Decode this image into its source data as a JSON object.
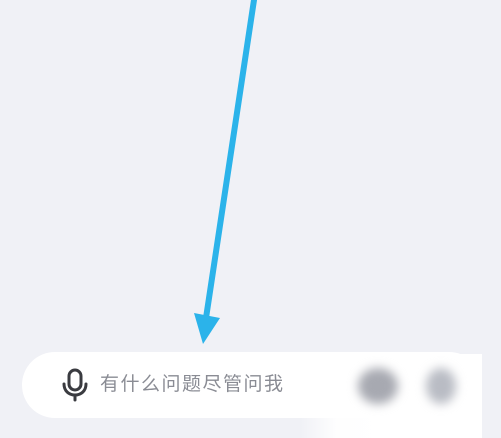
{
  "input": {
    "placeholder": "有什么问题尽管问我"
  },
  "icons": {
    "mic": "microphone-icon",
    "arrow": "annotation-arrow-icon"
  },
  "colors": {
    "background": "#f0f1f6",
    "input_bar": "#ffffff",
    "placeholder_text": "#8a8c94",
    "mic_icon": "#3a3b40",
    "annotation_arrow": "#2bb3ea"
  }
}
